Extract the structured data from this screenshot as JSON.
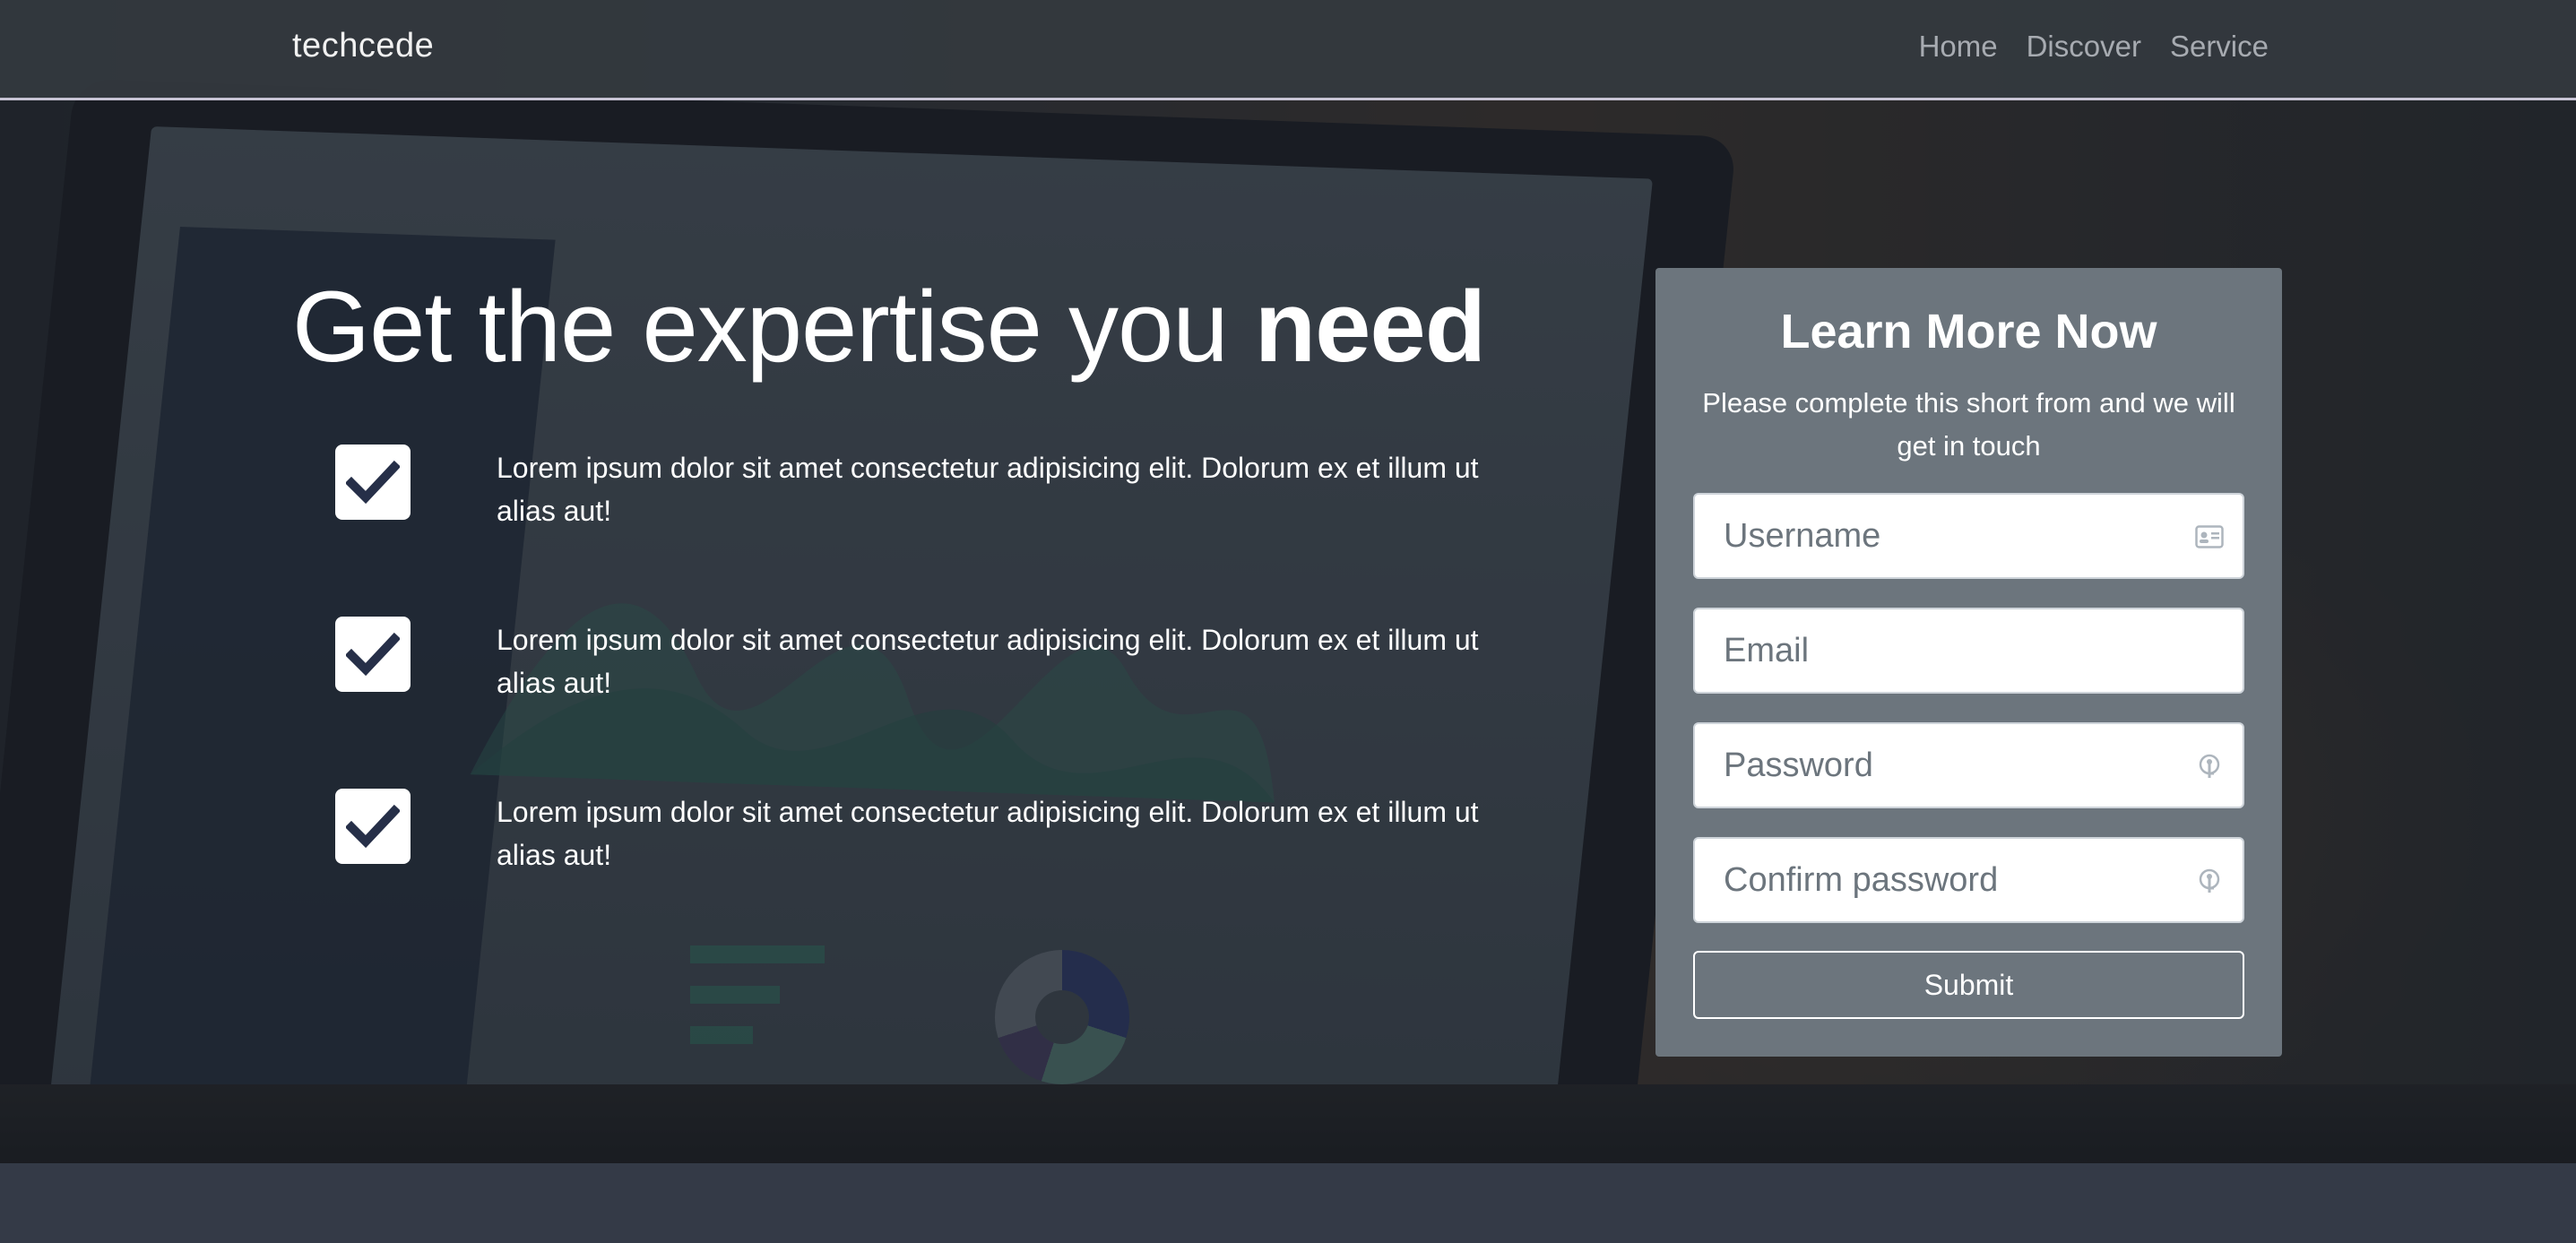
{
  "navbar": {
    "brand": "techcede",
    "links": [
      "Home",
      "Discover",
      "Service"
    ]
  },
  "hero": {
    "headline_light": "Get the expertise you ",
    "headline_bold": "need",
    "features": [
      {
        "icon": "checkbox-checked-icon",
        "text": "Lorem ipsum dolor sit amet consectetur adipisicing elit. Dolorum ex et illum ut alias aut!"
      },
      {
        "icon": "checkbox-checked-icon",
        "text": "Lorem ipsum dolor sit amet consectetur adipisicing elit. Dolorum ex et illum ut alias aut!"
      },
      {
        "icon": "checkbox-checked-icon",
        "text": "Lorem ipsum dolor sit amet consectetur adipisicing elit. Dolorum ex et illum ut alias aut!"
      }
    ]
  },
  "form": {
    "title": "Learn More Now",
    "subtitle": "Please complete this short from and we will get in touch",
    "fields": {
      "username": {
        "placeholder": "Username",
        "value": "",
        "icon": "id-card-icon"
      },
      "email": {
        "placeholder": "Email",
        "value": ""
      },
      "password": {
        "placeholder": "Password",
        "value": "",
        "icon": "key-icon"
      },
      "confirm": {
        "placeholder": "Confirm password",
        "value": "",
        "icon": "key-icon"
      }
    },
    "submit_label": "Submit"
  },
  "colors": {
    "navbar_bg": "#343a40",
    "card_bg": "#6c757d",
    "checkbox_check": "#262f48",
    "bottom_strip": "#343a47"
  }
}
